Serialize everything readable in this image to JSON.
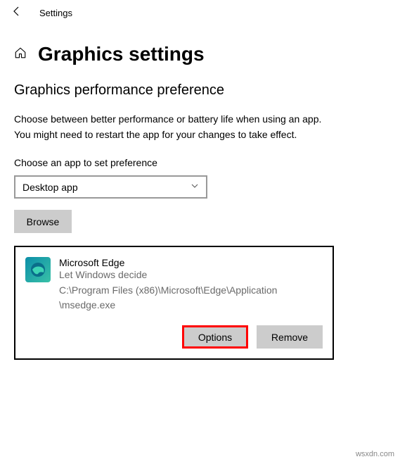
{
  "header": {
    "title": "Settings"
  },
  "page": {
    "title": "Graphics settings"
  },
  "section": {
    "heading": "Graphics performance preference",
    "description": "Choose between better performance or battery life when using an app.",
    "subdescription": "You might need to restart the app for your changes to take effect."
  },
  "chooser": {
    "label": "Choose an app to set preference",
    "selected": "Desktop app",
    "browse_label": "Browse"
  },
  "app": {
    "name": "Microsoft Edge",
    "preference": "Let Windows decide",
    "path_line1": "C:\\Program Files (x86)\\Microsoft\\Edge\\Application",
    "path_line2": "\\msedge.exe",
    "options_label": "Options",
    "remove_label": "Remove"
  },
  "watermark": "wsxdn.com"
}
